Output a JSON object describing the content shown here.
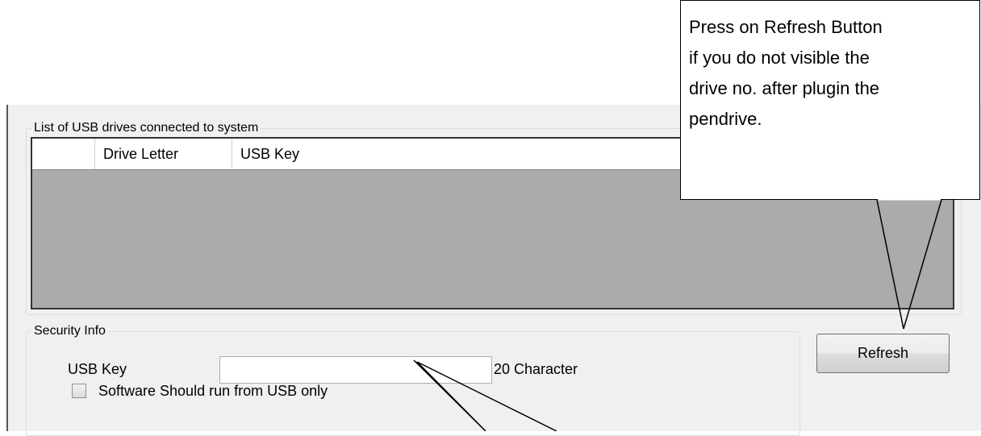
{
  "callout": {
    "text": "Press on Refresh Button\nif you do not visible the\ndrive no. after plugin the\npendrive."
  },
  "usb_list": {
    "group_title": "List of USB drives connected to system",
    "columns": [
      "Drive Letter",
      "USB Key"
    ],
    "rows": []
  },
  "security": {
    "group_title": "Security Info",
    "usb_key_label": "USB Key",
    "usb_key_value": "",
    "usb_key_hint": "20 Character",
    "checkbox_label": "Software Should run from USB only",
    "checkbox_checked": false
  },
  "buttons": {
    "refresh": "Refresh"
  }
}
